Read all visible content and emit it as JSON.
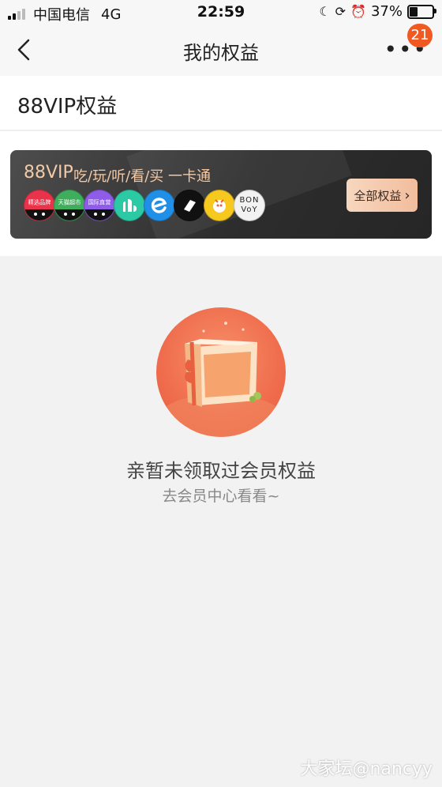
{
  "status_bar": {
    "carrier": "中国电信",
    "network": "4G",
    "time": "22:59",
    "battery": "37%",
    "battery_level": 0.37
  },
  "nav": {
    "title": "我的权益",
    "badge_count": "21"
  },
  "section": {
    "title": "88VIP权益"
  },
  "vip_card": {
    "brand": "88VIP",
    "slogan": "吃/玩/听/看/买 一卡通",
    "all_button": "全部权益",
    "partners": [
      {
        "label": "精选品牌",
        "color": "#e8334a",
        "icon": "tmall-cat"
      },
      {
        "label": "天猫超市",
        "color": "#3fae5c",
        "icon": "tmall-cat"
      },
      {
        "label": "国际直营",
        "color": "#8e5ce6",
        "icon": "tmall-cat"
      },
      {
        "label": "",
        "color": "#2bcaa5",
        "icon": "youku-icon"
      },
      {
        "label": "",
        "color": "#1f8fe8",
        "icon": "eleme-icon"
      },
      {
        "label": "",
        "color": "#111111",
        "icon": "xiami-icon"
      },
      {
        "label": "",
        "color": "#f7c81e",
        "icon": "fliggy-icon"
      },
      {
        "label": "BON VoY",
        "color": "#f2f2f2",
        "icon": "bonvoy-icon"
      }
    ]
  },
  "empty_state": {
    "message": "亲暂未领取过会员权益",
    "hint": "去会员中心看看~"
  },
  "watermark": "大家坛@nancyy"
}
